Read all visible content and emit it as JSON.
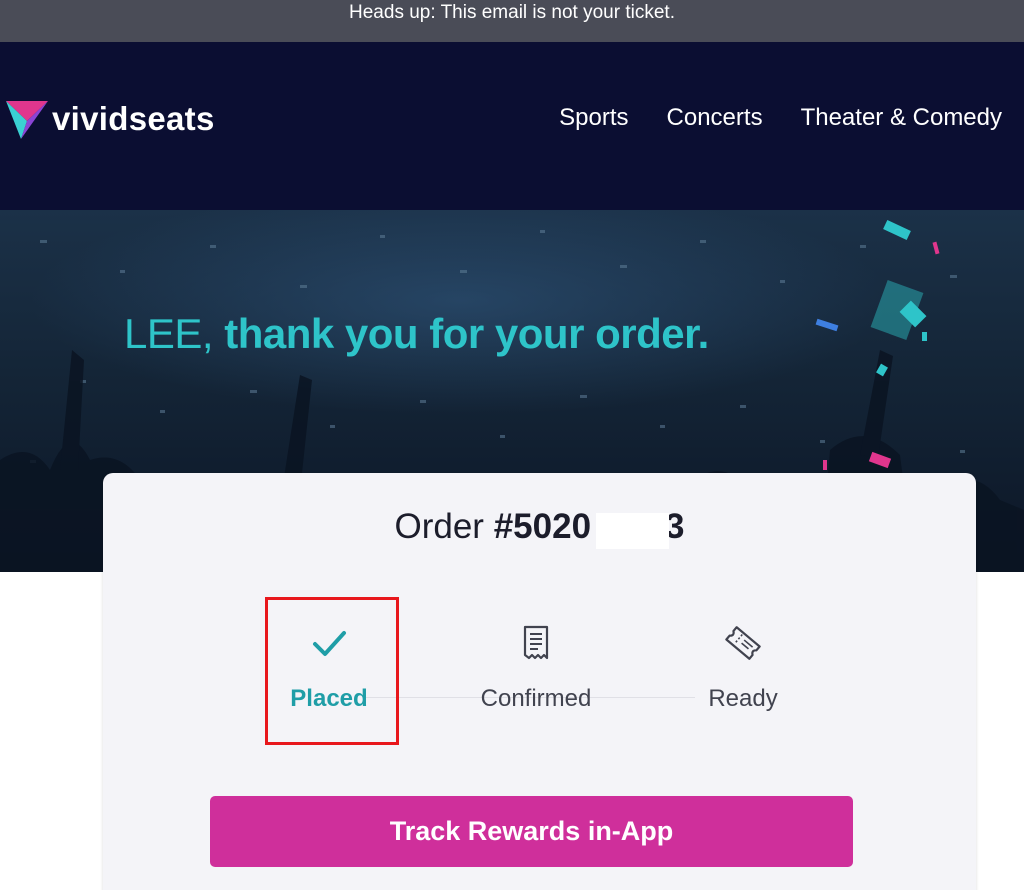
{
  "banner": {
    "text": "Heads up: This email is not your ticket."
  },
  "header": {
    "logo_text": "vividseats",
    "nav": [
      {
        "label": "Sports"
      },
      {
        "label": "Concerts"
      },
      {
        "label": "Theater & Comedy"
      }
    ]
  },
  "hero": {
    "name": "LEE,",
    "message": " thank you for your order."
  },
  "order": {
    "label": "Order ",
    "number_visible": "#5020",
    "number_tail": "3",
    "steps": [
      {
        "label": "Placed",
        "icon": "checkmark-icon",
        "status": "active"
      },
      {
        "label": "Confirmed",
        "icon": "receipt-icon",
        "status": "pending"
      },
      {
        "label": "Ready",
        "icon": "ticket-icon",
        "status": "pending"
      }
    ],
    "cta_label": "Track Rewards in-App"
  },
  "colors": {
    "banner_bg": "#4a4c57",
    "header_bg": "#0b0e32",
    "accent_teal": "#2ec4c9",
    "step_active": "#1f9ea7",
    "cta_pink": "#cf2f9b",
    "highlight_red": "#e8171c"
  }
}
